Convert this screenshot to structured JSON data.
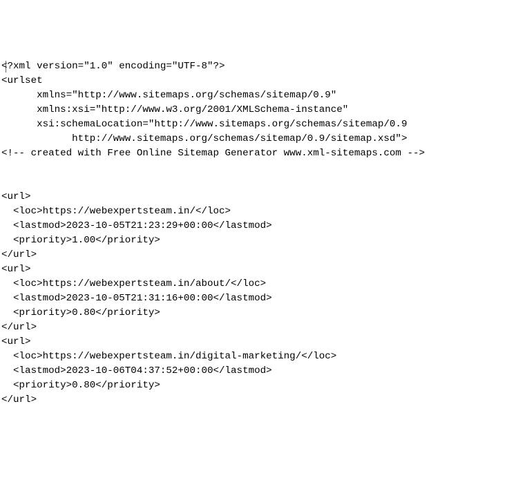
{
  "xml": {
    "declaration": "<?xml version=\"1.0\" encoding=\"UTF-8\"?>",
    "openUrlset": "<urlset",
    "attrXmlns": "      xmlns=\"http://www.sitemaps.org/schemas/sitemap/0.9\"",
    "attrXmlnsXsi": "      xmlns:xsi=\"http://www.w3.org/2001/XMLSchema-instance\"",
    "attrSchemaLoc": "      xsi:schemaLocation=\"http://www.sitemaps.org/schemas/sitemap/0.9",
    "schemaLocCont": "            http://www.sitemaps.org/schemas/sitemap/0.9/sitemap.xsd\">",
    "comment": "<!-- created with Free Online Sitemap Generator www.xml-sitemaps.com -->",
    "entries": [
      {
        "open": "<url>",
        "loc": "  <loc>https://webexpertsteam.in/</loc>",
        "lastmod": "  <lastmod>2023-10-05T21:23:29+00:00</lastmod>",
        "priority": "  <priority>1.00</priority>",
        "close": "</url>"
      },
      {
        "open": "<url>",
        "loc": "  <loc>https://webexpertsteam.in/about/</loc>",
        "lastmod": "  <lastmod>2023-10-05T21:31:16+00:00</lastmod>",
        "priority": "  <priority>0.80</priority>",
        "close": "</url>"
      },
      {
        "open": "<url>",
        "loc": "  <loc>https://webexpertsteam.in/digital-marketing/</loc>",
        "lastmod": "  <lastmod>2023-10-06T04:37:52+00:00</lastmod>",
        "priority": "  <priority>0.80</priority>",
        "close": "</url>"
      }
    ]
  }
}
